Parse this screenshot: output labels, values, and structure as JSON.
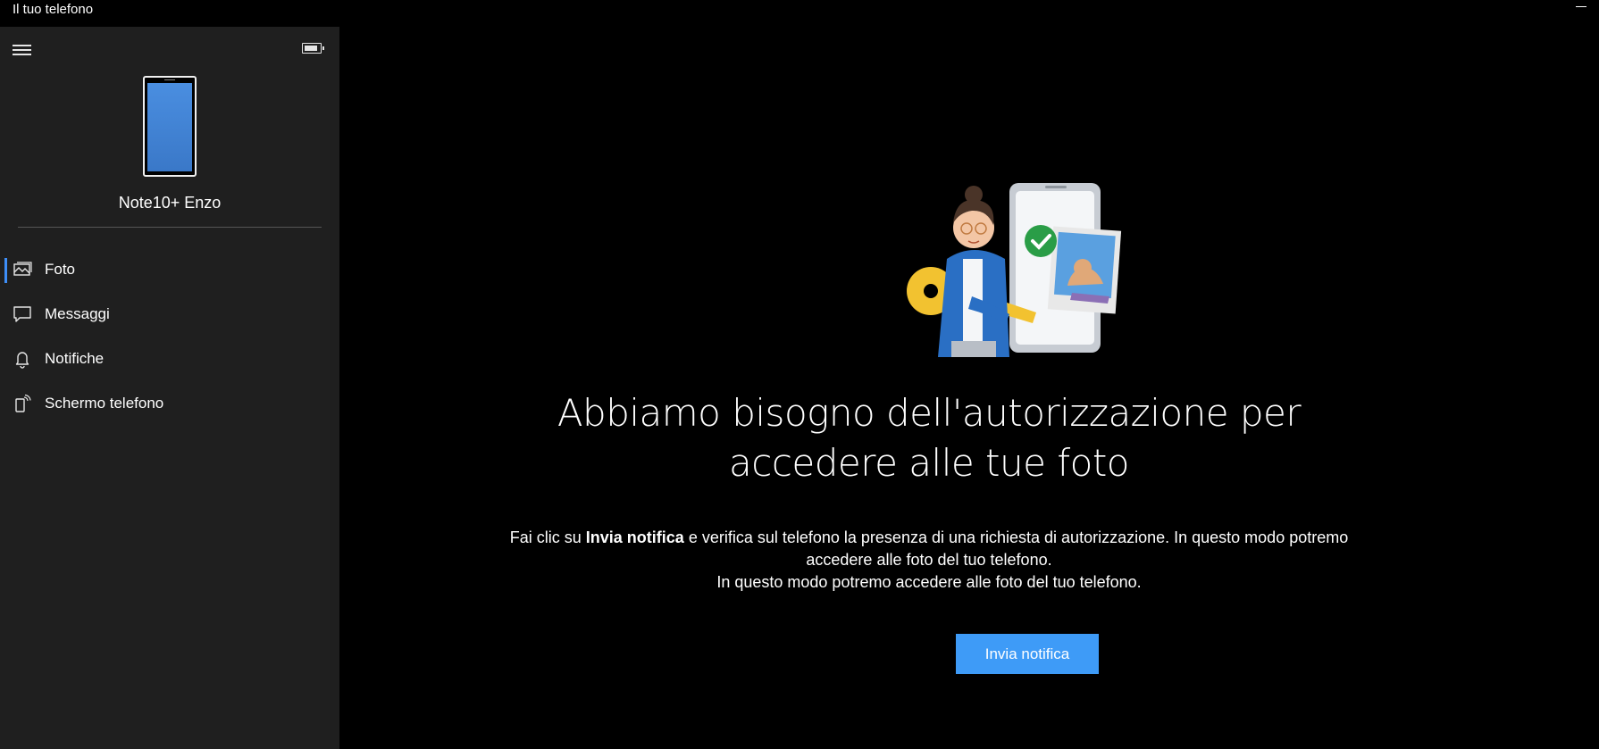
{
  "window": {
    "title": "Il tuo telefono"
  },
  "sidebar": {
    "device_name": "Note10+ Enzo",
    "items": [
      {
        "label": "Foto",
        "icon": "photos-icon",
        "selected": true
      },
      {
        "label": "Messaggi",
        "icon": "message-icon",
        "selected": false
      },
      {
        "label": "Notifiche",
        "icon": "bell-icon",
        "selected": false
      },
      {
        "label": "Schermo telefono",
        "icon": "phone-screen-icon",
        "selected": false
      }
    ]
  },
  "main": {
    "headline": "Abbiamo bisogno dell'autorizzazione per accedere alle tue foto",
    "body_prefix": "Fai clic su ",
    "body_bold": "Invia notifica",
    "body_suffix": " e verifica sul telefono la presenza di una richiesta di autorizzazione. In questo modo potremo accedere alle foto del tuo telefono.",
    "body_line2": "In questo modo potremo accedere alle foto del tuo telefono.",
    "button_label": "Invia notifica"
  },
  "colors": {
    "accent": "#3e9bf7",
    "sidebar_bg": "#1f1f1f",
    "main_bg": "#000000"
  }
}
